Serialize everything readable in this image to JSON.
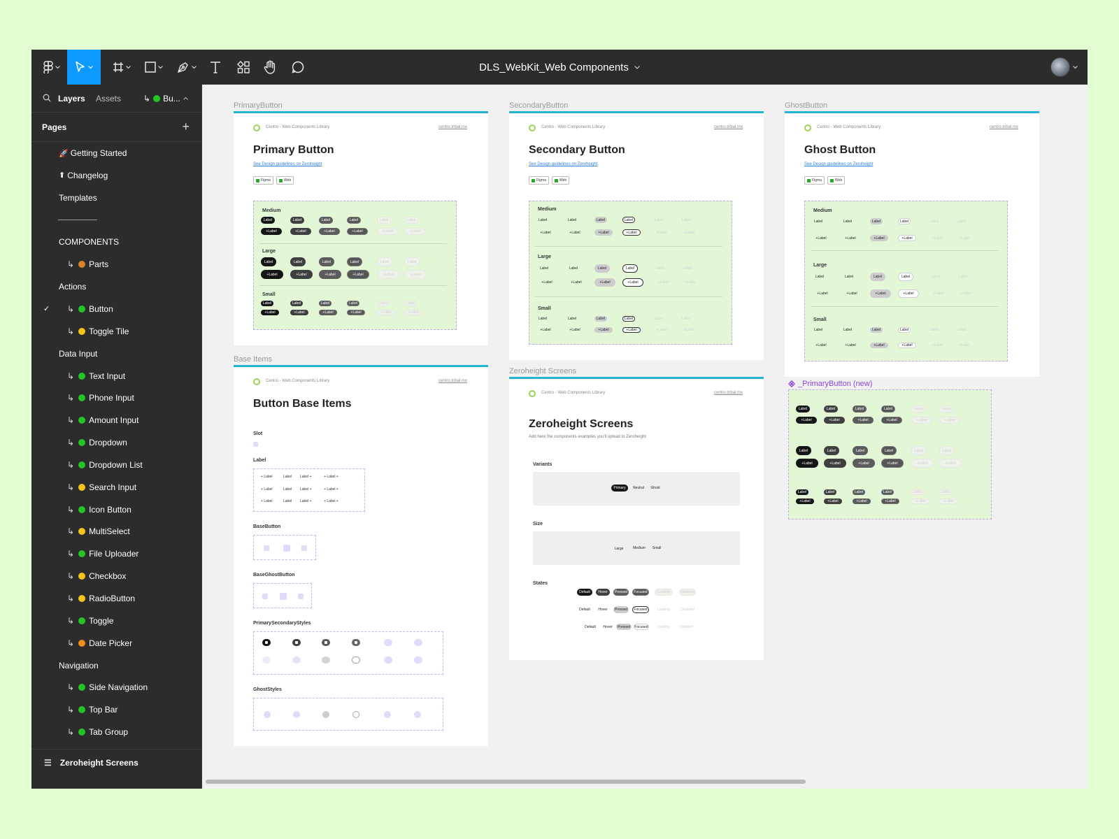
{
  "app": {
    "document_title": "DLS_WebKit_Web Components",
    "accent": "#0d99ff"
  },
  "toolbar": {
    "tools": [
      {
        "name": "main-menu",
        "icon": "figma-logo-icon"
      },
      {
        "name": "move",
        "icon": "cursor-icon",
        "active": true
      },
      {
        "name": "frame",
        "icon": "hash-icon"
      },
      {
        "name": "shape",
        "icon": "rectangle-icon"
      },
      {
        "name": "pen",
        "icon": "pen-icon"
      },
      {
        "name": "text",
        "icon": "text-icon"
      },
      {
        "name": "resources",
        "icon": "resources-icon"
      },
      {
        "name": "hand",
        "icon": "hand-icon"
      },
      {
        "name": "comment",
        "icon": "comment-icon"
      }
    ]
  },
  "sidebar": {
    "tabs": {
      "layers": "Layers",
      "assets": "Assets",
      "current_page": "Bu..."
    },
    "pages_label": "Pages",
    "pages": [
      {
        "label": "Getting Started",
        "emoji": "🚀",
        "indent": 0
      },
      {
        "label": "Changelog",
        "emoji": "⬆",
        "indent": 0
      },
      {
        "label": "Templates",
        "indent": 0
      },
      {
        "label": "",
        "divider": true
      },
      {
        "label": "COMPONENTS",
        "indent": 0
      },
      {
        "label": "Parts",
        "indent": 1,
        "dot": "#d9812b"
      },
      {
        "label": "Actions",
        "indent": 0
      },
      {
        "label": "Button",
        "indent": 1,
        "dot": "#22c524",
        "selected": true
      },
      {
        "label": "Toggle Tile",
        "indent": 1,
        "dot": "#f6c51b"
      },
      {
        "label": "Data Input",
        "indent": 0
      },
      {
        "label": "Text Input",
        "indent": 1,
        "dot": "#22c524"
      },
      {
        "label": "Phone Input",
        "indent": 1,
        "dot": "#22c524"
      },
      {
        "label": "Amount Input",
        "indent": 1,
        "dot": "#22c524"
      },
      {
        "label": "Dropdown",
        "indent": 1,
        "dot": "#22c524"
      },
      {
        "label": "Dropdown List",
        "indent": 1,
        "dot": "#22c524"
      },
      {
        "label": "Search Input",
        "indent": 1,
        "dot": "#f6c51b"
      },
      {
        "label": "Icon Button",
        "indent": 1,
        "dot": "#22c524"
      },
      {
        "label": "MultiSelect",
        "indent": 1,
        "dot": "#f6c51b"
      },
      {
        "label": "File Uploader",
        "indent": 1,
        "dot": "#22c524"
      },
      {
        "label": "Checkbox",
        "indent": 1,
        "dot": "#f6c51b"
      },
      {
        "label": "RadioButton",
        "indent": 1,
        "dot": "#f6c51b"
      },
      {
        "label": "Toggle",
        "indent": 1,
        "dot": "#22c524"
      },
      {
        "label": "Date Picker",
        "indent": 1,
        "dot": "#f28c1c"
      },
      {
        "label": "Navigation",
        "indent": 0
      },
      {
        "label": "Side Navigation",
        "indent": 1,
        "dot": "#22c524"
      },
      {
        "label": "Top Bar",
        "indent": 1,
        "dot": "#22c524"
      },
      {
        "label": "Tab Group",
        "indent": 1,
        "dot": "#22c524"
      }
    ],
    "footer_layer": "Zeroheight Screens"
  },
  "canvas": {
    "library_name": "Centro - Web Components Library",
    "library_url": "centro.tribal.mx",
    "guidelines_link": "See Design guidelines on Zeroheight",
    "tags": [
      "Figma",
      "Web"
    ],
    "button_label": "Label",
    "sizes": [
      "Medium",
      "Large",
      "Small"
    ],
    "frames": {
      "primary": {
        "name": "PrimaryButton",
        "title": "Primary Button"
      },
      "secondary": {
        "name": "SecondaryButton",
        "title": "Secondary Button"
      },
      "ghost": {
        "name": "GhostButton",
        "title": "Ghost Button"
      },
      "base": {
        "name": "Base Items",
        "title": "Button Base Items",
        "sections": [
          "Slot",
          "Label",
          "BaseButton",
          "BaseGhostButton",
          "PrimarySecondaryStyles",
          "GhostStyles"
        ]
      },
      "zeroheight": {
        "name": "Zeroheight Screens",
        "title": "Zeroheight Screens",
        "subtitle": "Add here the components examples you'll upload to Zeroheight",
        "sections": [
          "Variants",
          "Size",
          "States"
        ],
        "variants": [
          "Primary",
          "Neutral",
          "Ghost"
        ],
        "sizes": [
          "Large",
          "Medium",
          "Small"
        ],
        "states": [
          "Default",
          "Hover",
          "Pressed",
          "Focused",
          "Loading",
          "Disabled"
        ]
      }
    },
    "component": {
      "name": "_PrimaryButton (new)",
      "color": "#8b45d9"
    }
  }
}
